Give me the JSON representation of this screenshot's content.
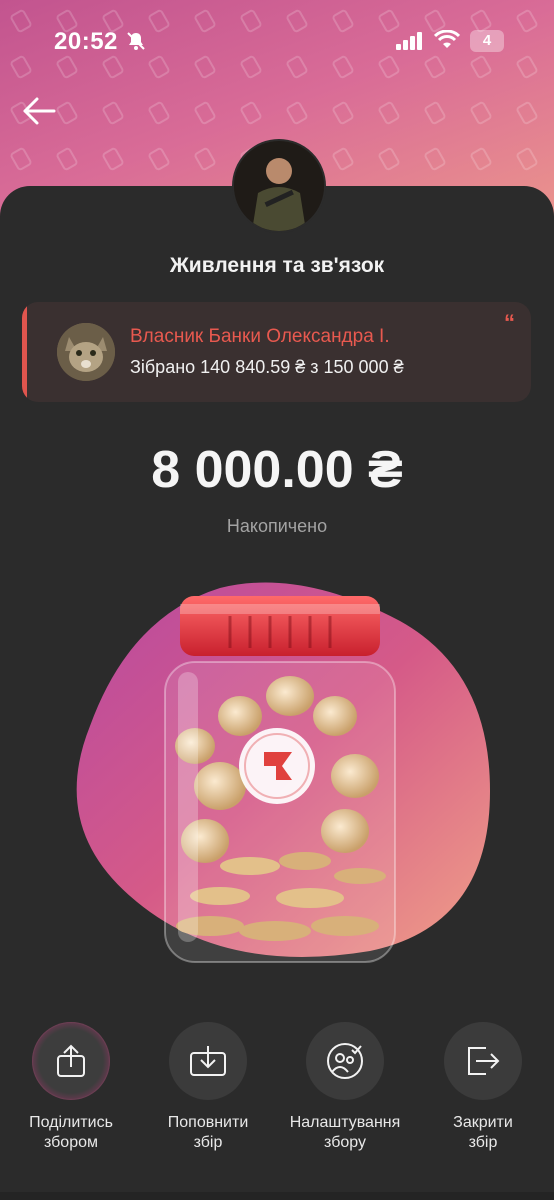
{
  "status_bar": {
    "time": "20:52",
    "battery": "4"
  },
  "colors": {
    "accent": "#e8594f",
    "header_gradient_start": "#c2548f",
    "header_gradient_end": "#ee9b8a",
    "card_bg": "#2b2b2b"
  },
  "header": {
    "back_icon": "arrow-left-icon"
  },
  "jar": {
    "title": "Живлення та зв'язок",
    "owner_name": "Власник Банки Олександра І.",
    "collected_text": "Зібрано 140 840.59 ₴ з 150 000 ₴",
    "collected_value": 140840.59,
    "goal_value": 150000,
    "accumulated_amount": "8 000.00 ₴",
    "accumulated_label": "Накопичено"
  },
  "actions": [
    {
      "label_line1": "Поділитись",
      "label_line2": "збором",
      "icon": "share-icon"
    },
    {
      "label_line1": "Поповнити",
      "label_line2": "збір",
      "icon": "top-up-icon"
    },
    {
      "label_line1": "Налаштування",
      "label_line2": "збору",
      "icon": "settings-group-icon"
    },
    {
      "label_line1": "Закрити",
      "label_line2": "збір",
      "icon": "close-jar-icon"
    }
  ]
}
